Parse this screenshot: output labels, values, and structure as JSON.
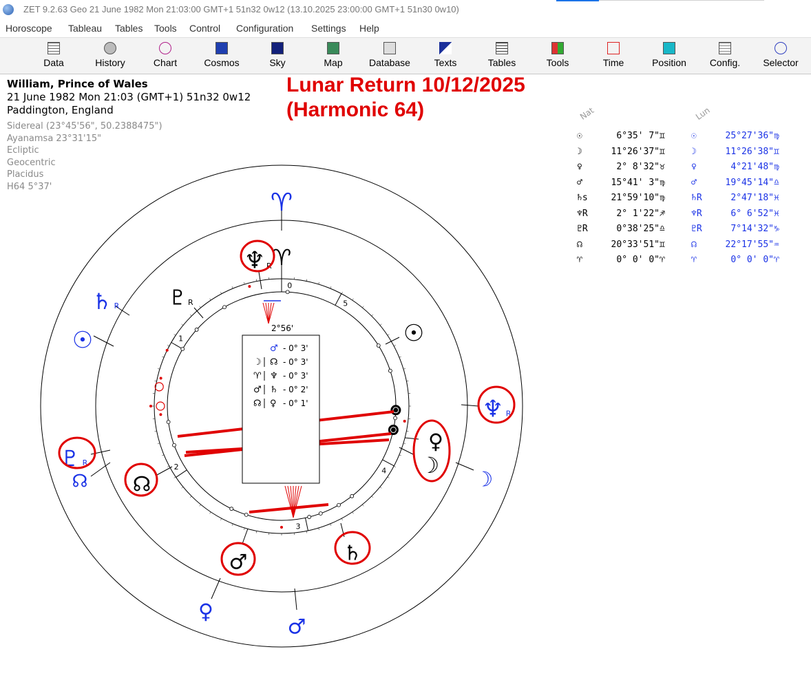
{
  "window": {
    "title": "ZET 9.2.63 Geo   21 June 1982  Mon  21:03:00 GMT+1 51n32  0w12  (13.10.2025  23:00:00 GMT+1 51n30 0w10)"
  },
  "menu": [
    "Horoscope",
    "Tableau",
    "Tables",
    "Tools",
    "Control",
    "Configuration",
    "Settings",
    "Help"
  ],
  "toolbar": [
    {
      "label": "Data",
      "icon": "data-grid-icon"
    },
    {
      "label": "History",
      "icon": "history-globe-icon"
    },
    {
      "label": "Chart",
      "icon": "chart-wheel-icon"
    },
    {
      "label": "Cosmos",
      "icon": "cosmos-icon"
    },
    {
      "label": "Sky",
      "icon": "sky-icon"
    },
    {
      "label": "Map",
      "icon": "map-icon"
    },
    {
      "label": "Database",
      "icon": "database-icon"
    },
    {
      "label": "Texts",
      "icon": "texts-icon"
    },
    {
      "label": "Tables",
      "icon": "tables-icon"
    },
    {
      "label": "Tools",
      "icon": "tools-icon"
    },
    {
      "label": "Time",
      "icon": "time-icon"
    },
    {
      "label": "Position",
      "icon": "position-icon"
    },
    {
      "label": "Config.",
      "icon": "config-icon"
    },
    {
      "label": "Selector",
      "icon": "selector-icon"
    }
  ],
  "info": {
    "name": "William, Prince of Wales",
    "datetime": "21 June 1982  Mon  21:03 (GMT+1) 51n32  0w12",
    "place": "Paddington, England",
    "details": [
      "Sidereal (23°45'56\", 50.2388475\")",
      "Ayanamsa 23°31'15\"",
      "Ecliptic",
      "Geocentric",
      "Placidus",
      "H64   5°37'"
    ]
  },
  "title": {
    "line1": "Lunar Return 10/12/2025",
    "line2": "(Harmonic 64)"
  },
  "positions": {
    "natal_header": "Nat",
    "lunar_header": "Lun",
    "natal": [
      {
        "glyph": "☉",
        "value": "6°35' 7\"",
        "sign": "♊"
      },
      {
        "glyph": "☽",
        "value": "11°26'37\"",
        "sign": "♊"
      },
      {
        "glyph": "♀",
        "value": "2° 8'32\"",
        "sign": "♉"
      },
      {
        "glyph": "♂",
        "value": "15°41' 3\"",
        "sign": "♍"
      },
      {
        "glyph": "♄s",
        "value": "21°59'10\"",
        "sign": "♍"
      },
      {
        "glyph": "♆R",
        "value": "2° 1'22\"",
        "sign": "♐"
      },
      {
        "glyph": "♇R",
        "value": "0°38'25\"",
        "sign": "♎"
      },
      {
        "glyph": "☊",
        "value": "20°33'51\"",
        "sign": "♊"
      },
      {
        "glyph": "♈",
        "value": "0° 0' 0\"",
        "sign": "♈"
      }
    ],
    "lunar": [
      {
        "glyph": "☉",
        "value": "25°27'36\"",
        "sign": "♍"
      },
      {
        "glyph": "☽",
        "value": "11°26'38\"",
        "sign": "♊"
      },
      {
        "glyph": "♀",
        "value": "4°21'48\"",
        "sign": "♍"
      },
      {
        "glyph": "♂",
        "value": "19°45'14\"",
        "sign": "♎"
      },
      {
        "glyph": "♄R",
        "value": "2°47'18\"",
        "sign": "♓"
      },
      {
        "glyph": "♆R",
        "value": "6° 6'52\"",
        "sign": "♓"
      },
      {
        "glyph": "♇R",
        "value": "7°14'32\"",
        "sign": "♑"
      },
      {
        "glyph": "☊",
        "value": "22°17'55\"",
        "sign": "♒"
      },
      {
        "glyph": "♈",
        "value": "0° 0' 0\"",
        "sign": "♈"
      }
    ]
  },
  "aspects": [
    {
      "p1": "",
      "p2": "♂",
      "orb": "- 0° 3'"
    },
    {
      "p1": "☽",
      "p2": "☊",
      "orb": "- 0° 3'"
    },
    {
      "p1": "♈",
      "p2": "♆",
      "orb": "- 0° 3'"
    },
    {
      "p1": "♂",
      "p2": "♄",
      "orb": "- 0° 2'"
    },
    {
      "p1": "☊",
      "p2": "♀",
      "orb": "- 0° 1'"
    }
  ],
  "wheel": {
    "angle_label": "2°56'",
    "house_labels": [
      "0",
      "5",
      "1",
      "4",
      "2",
      "3"
    ],
    "natal_outer": [
      {
        "key": "aries",
        "glyph": "♈"
      },
      {
        "key": "saturn",
        "glyph": "♄",
        "retro": "R"
      },
      {
        "key": "sun",
        "glyph": "☉"
      },
      {
        "key": "pluto",
        "glyph": "♇",
        "retro": "R"
      },
      {
        "key": "node",
        "glyph": "☊"
      },
      {
        "key": "venus",
        "glyph": "♀"
      },
      {
        "key": "mars",
        "glyph": "♂"
      },
      {
        "key": "moon",
        "glyph": "☽"
      },
      {
        "key": "neptune",
        "glyph": "♆",
        "retro": "R"
      }
    ],
    "lunar_inner": [
      {
        "key": "aries",
        "glyph": "♈"
      },
      {
        "key": "neptune",
        "glyph": "♆",
        "retro": "R"
      },
      {
        "key": "pluto",
        "glyph": "♇",
        "retro": "R"
      },
      {
        "key": "sun",
        "glyph": "☉"
      },
      {
        "key": "venus",
        "glyph": "♀"
      },
      {
        "key": "moon",
        "glyph": "☽"
      },
      {
        "key": "node",
        "glyph": "☊"
      },
      {
        "key": "mars",
        "glyph": "♂"
      },
      {
        "key": "saturn",
        "glyph": "♄"
      }
    ]
  },
  "colors": {
    "natal": "#1a32e6",
    "lunar": "#000000",
    "highlight": "#e00000"
  }
}
